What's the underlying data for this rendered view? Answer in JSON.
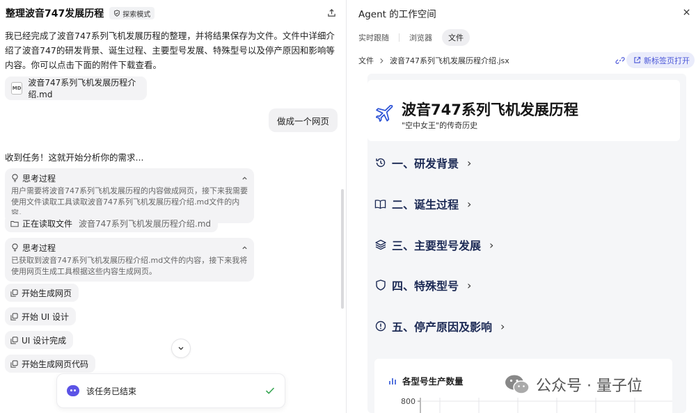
{
  "chat": {
    "title": "整理波音747发展历程",
    "mode_label": "探索模式",
    "assistant_message": "我已经完成了波音747系列飞机发展历程的整理，并将结果保存为文件。文件中详细介绍了波音747的研发背景、诞生过程、主要型号发展、特殊型号以及停产原因和影响等内容。你可以点击下面的附件下载查看。",
    "attachment_name": "波音747系列飞机发展历程介绍.md",
    "attachment_icon_text": "MD",
    "user_message": "做成一个网页",
    "task_start": "收到任务！这就开始分析你的需求...",
    "thinking": [
      {
        "label": "思考过程",
        "text": "用户需要将波音747系列飞机发展历程的内容做成网页，接下来我需要使用文件读取工具读取波音747系列飞机发展历程介绍.md文件的内容。"
      },
      {
        "label": "思考过程",
        "text": "已获取到波音747系列飞机发展历程介绍.md文件的内容，接下来我将使用网页生成工具根据这些内容生成网页。"
      }
    ],
    "reading_step": {
      "label": "正在读取文件",
      "file": "波音747系列飞机发展历程介绍.md"
    },
    "steps": [
      "开始生成网页",
      "开始 UI 设计",
      "UI 设计完成",
      "开始生成网页代码"
    ],
    "toast": "该任务已结束"
  },
  "workspace": {
    "title": "Agent 的工作空间",
    "tabs": [
      "实时跟随",
      "浏览器",
      "文件"
    ],
    "active_tab": "文件",
    "breadcrumb_root": "文件",
    "breadcrumb_file": "波音747系列飞机发展历程介绍.jsx",
    "open_new_tab": "新标签页打开",
    "preview": {
      "title": "波音747系列飞机发展历程",
      "subtitle": "\"空中女王\"的传奇历史",
      "sections": [
        {
          "label": "一、研发背景",
          "icon": "history-icon"
        },
        {
          "label": "二、诞生过程",
          "icon": "book-icon"
        },
        {
          "label": "三、主要型号发展",
          "icon": "layers-icon"
        },
        {
          "label": "四、特殊型号",
          "icon": "shield-icon"
        },
        {
          "label": "五、停产原因及影响",
          "icon": "alert-icon"
        }
      ],
      "chart_title": "各型号生产数量",
      "chart_tick": "800"
    }
  },
  "watermark": "公众号 · 量子位",
  "colors": {
    "accent": "#4a56d8",
    "heading": "#1c2a55",
    "success": "#3aa655",
    "bot": "#5b53e6"
  }
}
